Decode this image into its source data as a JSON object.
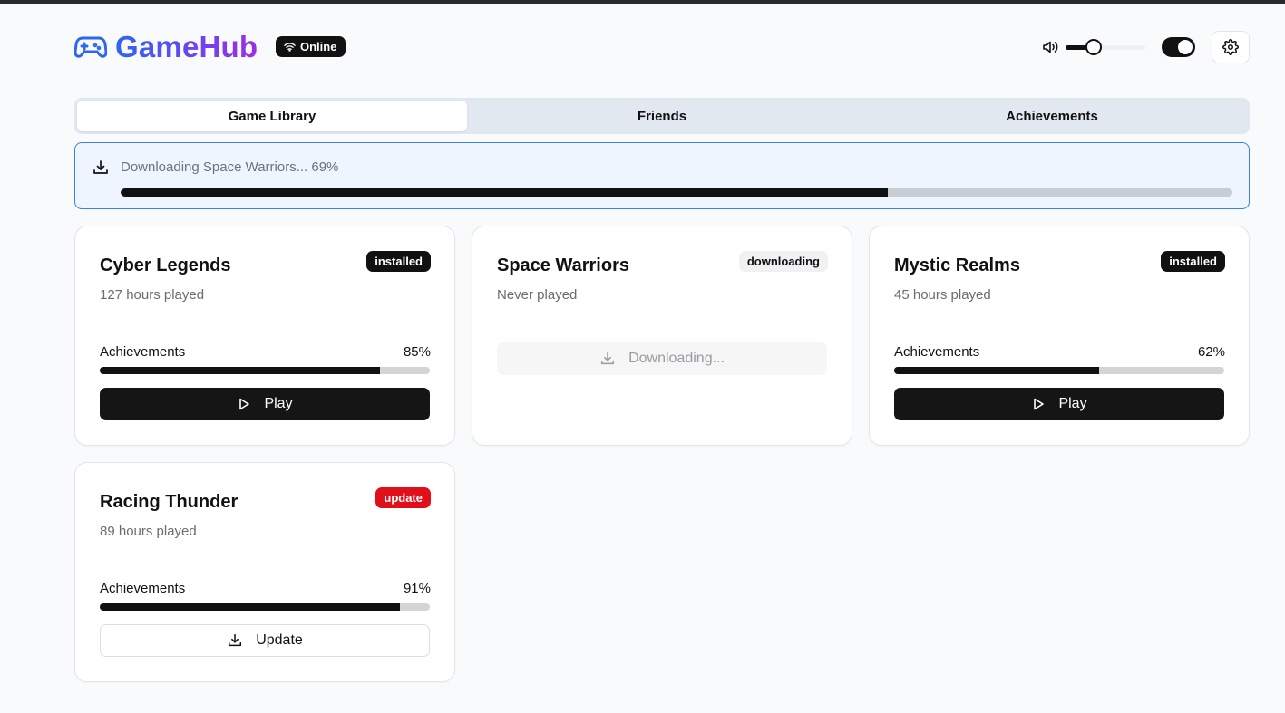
{
  "app": {
    "name": "GameHub",
    "status": "Online",
    "brand_gradient": [
      "#2f66f0",
      "#9b2fe6"
    ]
  },
  "volume": {
    "level": 0.28
  },
  "theme_toggle": {
    "on": true
  },
  "tabs": [
    {
      "label": "Game Library",
      "active": true
    },
    {
      "label": "Friends",
      "active": false
    },
    {
      "label": "Achievements",
      "active": false
    }
  ],
  "download": {
    "text": "Downloading Space Warriors... 69%",
    "progress": 69
  },
  "games": [
    {
      "title": "Cyber Legends",
      "subtitle": "127 hours played",
      "badge": "installed",
      "achievements_label": "Achievements",
      "achievements_pct": "85%",
      "achievements_value": 85,
      "button": "Play"
    },
    {
      "title": "Space Warriors",
      "subtitle": "Never played",
      "badge": "downloading",
      "button": "Downloading..."
    },
    {
      "title": "Mystic Realms",
      "subtitle": "45 hours played",
      "badge": "installed",
      "achievements_label": "Achievements",
      "achievements_pct": "62%",
      "achievements_value": 62,
      "button": "Play"
    },
    {
      "title": "Racing Thunder",
      "subtitle": "89 hours played",
      "badge": "update",
      "achievements_label": "Achievements",
      "achievements_pct": "91%",
      "achievements_value": 91,
      "button": "Update"
    }
  ],
  "colors": {
    "accent": "#3a7ff0",
    "update_badge": "#e0101a",
    "dark": "#111111"
  }
}
